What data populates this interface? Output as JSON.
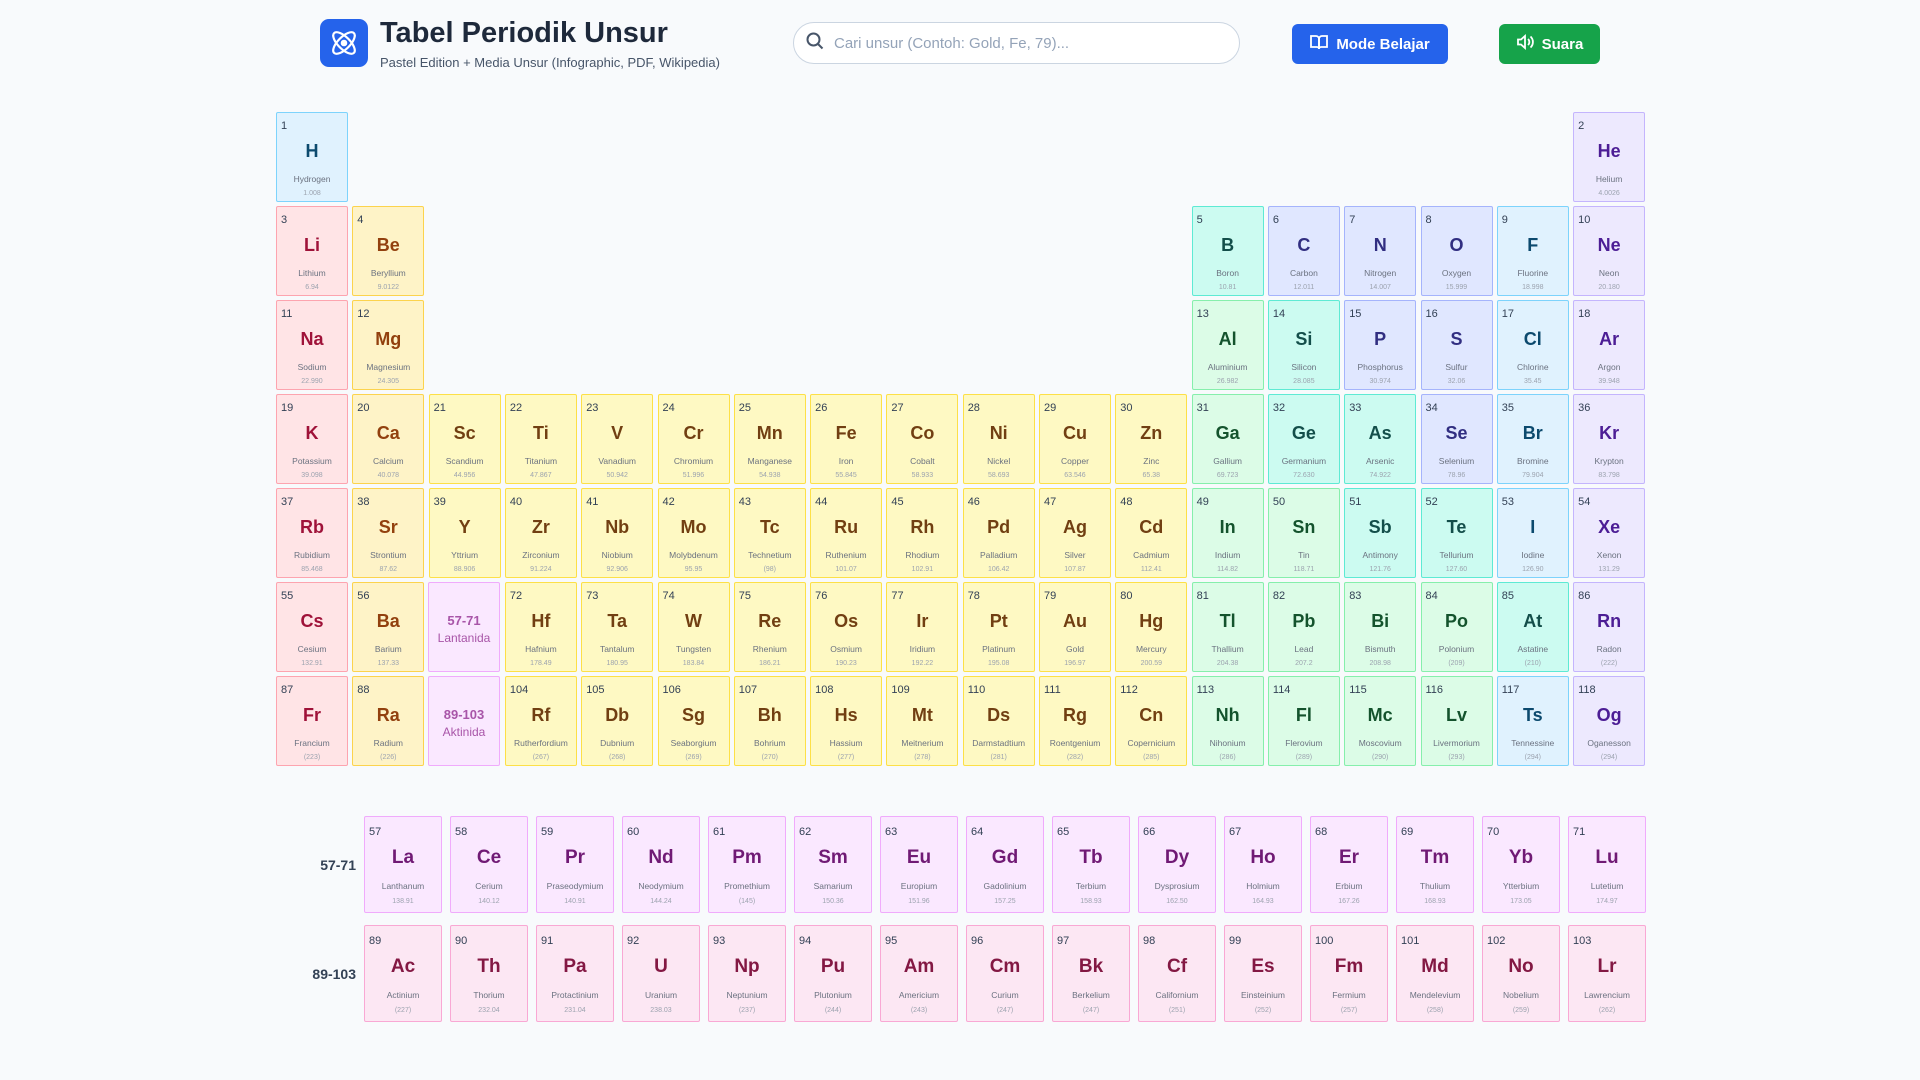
{
  "header": {
    "title": "Tabel Periodik Unsur",
    "subtitle": "Pastel Edition + Media Unsur (Infographic, PDF, Wikipedia)",
    "search_placeholder": "Cari unsur (Contoh: Gold, Fe, 79)...",
    "learn_label": "Mode Belajar",
    "sound_label": "Suara"
  },
  "placeholders": {
    "lanthanide": {
      "range": "57-71",
      "label": "Lantanida"
    },
    "actinide": {
      "range": "89-103",
      "label": "Aktinida"
    }
  },
  "row_labels": {
    "lanthanide": "57-71",
    "actinide": "89-103"
  },
  "elements": [
    {
      "n": 1,
      "s": "H",
      "name": "Hydrogen",
      "m": "1.008",
      "c": "h",
      "g": 1,
      "p": 1
    },
    {
      "n": 2,
      "s": "He",
      "name": "Helium",
      "m": "4.0026",
      "c": "ng",
      "g": 18,
      "p": 1
    },
    {
      "n": 3,
      "s": "Li",
      "name": "Lithium",
      "m": "6.94",
      "c": "alk",
      "g": 1,
      "p": 2
    },
    {
      "n": 4,
      "s": "Be",
      "name": "Beryllium",
      "m": "9.0122",
      "c": "ae",
      "g": 2,
      "p": 2
    },
    {
      "n": 5,
      "s": "B",
      "name": "Boron",
      "m": "10.81",
      "c": "met",
      "g": 13,
      "p": 2
    },
    {
      "n": 6,
      "s": "C",
      "name": "Carbon",
      "m": "12.011",
      "c": "nm",
      "g": 14,
      "p": 2
    },
    {
      "n": 7,
      "s": "N",
      "name": "Nitrogen",
      "m": "14.007",
      "c": "nm",
      "g": 15,
      "p": 2
    },
    {
      "n": 8,
      "s": "O",
      "name": "Oxygen",
      "m": "15.999",
      "c": "nm",
      "g": 16,
      "p": 2
    },
    {
      "n": 9,
      "s": "F",
      "name": "Fluorine",
      "m": "18.998",
      "c": "hal",
      "g": 17,
      "p": 2
    },
    {
      "n": 10,
      "s": "Ne",
      "name": "Neon",
      "m": "20.180",
      "c": "ng",
      "g": 18,
      "p": 2
    },
    {
      "n": 11,
      "s": "Na",
      "name": "Sodium",
      "m": "22.990",
      "c": "alk",
      "g": 1,
      "p": 3
    },
    {
      "n": 12,
      "s": "Mg",
      "name": "Magnesium",
      "m": "24.305",
      "c": "ae",
      "g": 2,
      "p": 3
    },
    {
      "n": 13,
      "s": "Al",
      "name": "Aluminium",
      "m": "26.982",
      "c": "pt",
      "g": 13,
      "p": 3
    },
    {
      "n": 14,
      "s": "Si",
      "name": "Silicon",
      "m": "28.085",
      "c": "met",
      "g": 14,
      "p": 3
    },
    {
      "n": 15,
      "s": "P",
      "name": "Phosphorus",
      "m": "30.974",
      "c": "nm",
      "g": 15,
      "p": 3
    },
    {
      "n": 16,
      "s": "S",
      "name": "Sulfur",
      "m": "32.06",
      "c": "nm",
      "g": 16,
      "p": 3
    },
    {
      "n": 17,
      "s": "Cl",
      "name": "Chlorine",
      "m": "35.45",
      "c": "hal",
      "g": 17,
      "p": 3
    },
    {
      "n": 18,
      "s": "Ar",
      "name": "Argon",
      "m": "39.948",
      "c": "ng",
      "g": 18,
      "p": 3
    },
    {
      "n": 19,
      "s": "K",
      "name": "Potassium",
      "m": "39.098",
      "c": "alk",
      "g": 1,
      "p": 4
    },
    {
      "n": 20,
      "s": "Ca",
      "name": "Calcium",
      "m": "40.078",
      "c": "ae",
      "g": 2,
      "p": 4
    },
    {
      "n": 21,
      "s": "Sc",
      "name": "Scandium",
      "m": "44.956",
      "c": "tm",
      "g": 3,
      "p": 4
    },
    {
      "n": 22,
      "s": "Ti",
      "name": "Titanium",
      "m": "47.867",
      "c": "tm",
      "g": 4,
      "p": 4
    },
    {
      "n": 23,
      "s": "V",
      "name": "Vanadium",
      "m": "50.942",
      "c": "tm",
      "g": 5,
      "p": 4
    },
    {
      "n": 24,
      "s": "Cr",
      "name": "Chromium",
      "m": "51.996",
      "c": "tm",
      "g": 6,
      "p": 4
    },
    {
      "n": 25,
      "s": "Mn",
      "name": "Manganese",
      "m": "54.938",
      "c": "tm",
      "g": 7,
      "p": 4
    },
    {
      "n": 26,
      "s": "Fe",
      "name": "Iron",
      "m": "55.845",
      "c": "tm",
      "g": 8,
      "p": 4
    },
    {
      "n": 27,
      "s": "Co",
      "name": "Cobalt",
      "m": "58.933",
      "c": "tm",
      "g": 9,
      "p": 4
    },
    {
      "n": 28,
      "s": "Ni",
      "name": "Nickel",
      "m": "58.693",
      "c": "tm",
      "g": 10,
      "p": 4
    },
    {
      "n": 29,
      "s": "Cu",
      "name": "Copper",
      "m": "63.546",
      "c": "tm",
      "g": 11,
      "p": 4
    },
    {
      "n": 30,
      "s": "Zn",
      "name": "Zinc",
      "m": "65.38",
      "c": "tm",
      "g": 12,
      "p": 4
    },
    {
      "n": 31,
      "s": "Ga",
      "name": "Gallium",
      "m": "69.723",
      "c": "pt",
      "g": 13,
      "p": 4
    },
    {
      "n": 32,
      "s": "Ge",
      "name": "Germanium",
      "m": "72.630",
      "c": "met",
      "g": 14,
      "p": 4
    },
    {
      "n": 33,
      "s": "As",
      "name": "Arsenic",
      "m": "74.922",
      "c": "met",
      "g": 15,
      "p": 4
    },
    {
      "n": 34,
      "s": "Se",
      "name": "Selenium",
      "m": "78.96",
      "c": "nm",
      "g": 16,
      "p": 4
    },
    {
      "n": 35,
      "s": "Br",
      "name": "Bromine",
      "m": "79.904",
      "c": "hal",
      "g": 17,
      "p": 4
    },
    {
      "n": 36,
      "s": "Kr",
      "name": "Krypton",
      "m": "83.798",
      "c": "ng",
      "g": 18,
      "p": 4
    },
    {
      "n": 37,
      "s": "Rb",
      "name": "Rubidium",
      "m": "85.468",
      "c": "alk",
      "g": 1,
      "p": 5
    },
    {
      "n": 38,
      "s": "Sr",
      "name": "Strontium",
      "m": "87.62",
      "c": "ae",
      "g": 2,
      "p": 5
    },
    {
      "n": 39,
      "s": "Y",
      "name": "Yttrium",
      "m": "88.906",
      "c": "tm",
      "g": 3,
      "p": 5
    },
    {
      "n": 40,
      "s": "Zr",
      "name": "Zirconium",
      "m": "91.224",
      "c": "tm",
      "g": 4,
      "p": 5
    },
    {
      "n": 41,
      "s": "Nb",
      "name": "Niobium",
      "m": "92.906",
      "c": "tm",
      "g": 5,
      "p": 5
    },
    {
      "n": 42,
      "s": "Mo",
      "name": "Molybdenum",
      "m": "95.95",
      "c": "tm",
      "g": 6,
      "p": 5
    },
    {
      "n": 43,
      "s": "Tc",
      "name": "Technetium",
      "m": "(98)",
      "c": "tm",
      "g": 7,
      "p": 5
    },
    {
      "n": 44,
      "s": "Ru",
      "name": "Ruthenium",
      "m": "101.07",
      "c": "tm",
      "g": 8,
      "p": 5
    },
    {
      "n": 45,
      "s": "Rh",
      "name": "Rhodium",
      "m": "102.91",
      "c": "tm",
      "g": 9,
      "p": 5
    },
    {
      "n": 46,
      "s": "Pd",
      "name": "Palladium",
      "m": "106.42",
      "c": "tm",
      "g": 10,
      "p": 5
    },
    {
      "n": 47,
      "s": "Ag",
      "name": "Silver",
      "m": "107.87",
      "c": "tm",
      "g": 11,
      "p": 5
    },
    {
      "n": 48,
      "s": "Cd",
      "name": "Cadmium",
      "m": "112.41",
      "c": "tm",
      "g": 12,
      "p": 5
    },
    {
      "n": 49,
      "s": "In",
      "name": "Indium",
      "m": "114.82",
      "c": "pt",
      "g": 13,
      "p": 5
    },
    {
      "n": 50,
      "s": "Sn",
      "name": "Tin",
      "m": "118.71",
      "c": "pt",
      "g": 14,
      "p": 5
    },
    {
      "n": 51,
      "s": "Sb",
      "name": "Antimony",
      "m": "121.76",
      "c": "met",
      "g": 15,
      "p": 5
    },
    {
      "n": 52,
      "s": "Te",
      "name": "Tellurium",
      "m": "127.60",
      "c": "met",
      "g": 16,
      "p": 5
    },
    {
      "n": 53,
      "s": "I",
      "name": "Iodine",
      "m": "126.90",
      "c": "hal",
      "g": 17,
      "p": 5
    },
    {
      "n": 54,
      "s": "Xe",
      "name": "Xenon",
      "m": "131.29",
      "c": "ng",
      "g": 18,
      "p": 5
    },
    {
      "n": 55,
      "s": "Cs",
      "name": "Cesium",
      "m": "132.91",
      "c": "alk",
      "g": 1,
      "p": 6
    },
    {
      "n": 56,
      "s": "Ba",
      "name": "Barium",
      "m": "137.33",
      "c": "ae",
      "g": 2,
      "p": 6
    },
    {
      "n": 72,
      "s": "Hf",
      "name": "Hafnium",
      "m": "178.49",
      "c": "tm",
      "g": 4,
      "p": 6
    },
    {
      "n": 73,
      "s": "Ta",
      "name": "Tantalum",
      "m": "180.95",
      "c": "tm",
      "g": 5,
      "p": 6
    },
    {
      "n": 74,
      "s": "W",
      "name": "Tungsten",
      "m": "183.84",
      "c": "tm",
      "g": 6,
      "p": 6
    },
    {
      "n": 75,
      "s": "Re",
      "name": "Rhenium",
      "m": "186.21",
      "c": "tm",
      "g": 7,
      "p": 6
    },
    {
      "n": 76,
      "s": "Os",
      "name": "Osmium",
      "m": "190.23",
      "c": "tm",
      "g": 8,
      "p": 6
    },
    {
      "n": 77,
      "s": "Ir",
      "name": "Iridium",
      "m": "192.22",
      "c": "tm",
      "g": 9,
      "p": 6
    },
    {
      "n": 78,
      "s": "Pt",
      "name": "Platinum",
      "m": "195.08",
      "c": "tm",
      "g": 10,
      "p": 6
    },
    {
      "n": 79,
      "s": "Au",
      "name": "Gold",
      "m": "196.97",
      "c": "tm",
      "g": 11,
      "p": 6
    },
    {
      "n": 80,
      "s": "Hg",
      "name": "Mercury",
      "m": "200.59",
      "c": "tm",
      "g": 12,
      "p": 6
    },
    {
      "n": 81,
      "s": "Tl",
      "name": "Thallium",
      "m": "204.38",
      "c": "pt",
      "g": 13,
      "p": 6
    },
    {
      "n": 82,
      "s": "Pb",
      "name": "Lead",
      "m": "207.2",
      "c": "pt",
      "g": 14,
      "p": 6
    },
    {
      "n": 83,
      "s": "Bi",
      "name": "Bismuth",
      "m": "208.98",
      "c": "pt",
      "g": 15,
      "p": 6
    },
    {
      "n": 84,
      "s": "Po",
      "name": "Polonium",
      "m": "(209)",
      "c": "pt",
      "g": 16,
      "p": 6
    },
    {
      "n": 85,
      "s": "At",
      "name": "Astatine",
      "m": "(210)",
      "c": "met",
      "g": 17,
      "p": 6
    },
    {
      "n": 86,
      "s": "Rn",
      "name": "Radon",
      "m": "(222)",
      "c": "ng",
      "g": 18,
      "p": 6
    },
    {
      "n": 87,
      "s": "Fr",
      "name": "Francium",
      "m": "(223)",
      "c": "alk",
      "g": 1,
      "p": 7
    },
    {
      "n": 88,
      "s": "Ra",
      "name": "Radium",
      "m": "(226)",
      "c": "ae",
      "g": 2,
      "p": 7
    },
    {
      "n": 104,
      "s": "Rf",
      "name": "Rutherfordium",
      "m": "(267)",
      "c": "tm",
      "g": 4,
      "p": 7
    },
    {
      "n": 105,
      "s": "Db",
      "name": "Dubnium",
      "m": "(268)",
      "c": "tm",
      "g": 5,
      "p": 7
    },
    {
      "n": 106,
      "s": "Sg",
      "name": "Seaborgium",
      "m": "(269)",
      "c": "tm",
      "g": 6,
      "p": 7
    },
    {
      "n": 107,
      "s": "Bh",
      "name": "Bohrium",
      "m": "(270)",
      "c": "tm",
      "g": 7,
      "p": 7
    },
    {
      "n": 108,
      "s": "Hs",
      "name": "Hassium",
      "m": "(277)",
      "c": "tm",
      "g": 8,
      "p": 7
    },
    {
      "n": 109,
      "s": "Mt",
      "name": "Meitnerium",
      "m": "(278)",
      "c": "tm",
      "g": 9,
      "p": 7
    },
    {
      "n": 110,
      "s": "Ds",
      "name": "Darmstadtium",
      "m": "(281)",
      "c": "tm",
      "g": 10,
      "p": 7
    },
    {
      "n": 111,
      "s": "Rg",
      "name": "Roentgenium",
      "m": "(282)",
      "c": "tm",
      "g": 11,
      "p": 7
    },
    {
      "n": 112,
      "s": "Cn",
      "name": "Copernicium",
      "m": "(285)",
      "c": "tm",
      "g": 12,
      "p": 7
    },
    {
      "n": 113,
      "s": "Nh",
      "name": "Nihonium",
      "m": "(286)",
      "c": "pt",
      "g": 13,
      "p": 7
    },
    {
      "n": 114,
      "s": "Fl",
      "name": "Flerovium",
      "m": "(289)",
      "c": "pt",
      "g": 14,
      "p": 7
    },
    {
      "n": 115,
      "s": "Mc",
      "name": "Moscovium",
      "m": "(290)",
      "c": "pt",
      "g": 15,
      "p": 7
    },
    {
      "n": 116,
      "s": "Lv",
      "name": "Livermorium",
      "m": "(293)",
      "c": "pt",
      "g": 16,
      "p": 7
    },
    {
      "n": 117,
      "s": "Ts",
      "name": "Tennessine",
      "m": "(294)",
      "c": "hal",
      "g": 17,
      "p": 7
    },
    {
      "n": 118,
      "s": "Og",
      "name": "Oganesson",
      "m": "(294)",
      "c": "ng",
      "g": 18,
      "p": 7
    }
  ],
  "lanthanides": [
    {
      "n": 57,
      "s": "La",
      "name": "Lanthanum",
      "m": "138.91"
    },
    {
      "n": 58,
      "s": "Ce",
      "name": "Cerium",
      "m": "140.12"
    },
    {
      "n": 59,
      "s": "Pr",
      "name": "Praseodymium",
      "m": "140.91"
    },
    {
      "n": 60,
      "s": "Nd",
      "name": "Neodymium",
      "m": "144.24"
    },
    {
      "n": 61,
      "s": "Pm",
      "name": "Promethium",
      "m": "(145)"
    },
    {
      "n": 62,
      "s": "Sm",
      "name": "Samarium",
      "m": "150.36"
    },
    {
      "n": 63,
      "s": "Eu",
      "name": "Europium",
      "m": "151.96"
    },
    {
      "n": 64,
      "s": "Gd",
      "name": "Gadolinium",
      "m": "157.25"
    },
    {
      "n": 65,
      "s": "Tb",
      "name": "Terbium",
      "m": "158.93"
    },
    {
      "n": 66,
      "s": "Dy",
      "name": "Dysprosium",
      "m": "162.50"
    },
    {
      "n": 67,
      "s": "Ho",
      "name": "Holmium",
      "m": "164.93"
    },
    {
      "n": 68,
      "s": "Er",
      "name": "Erbium",
      "m": "167.26"
    },
    {
      "n": 69,
      "s": "Tm",
      "name": "Thulium",
      "m": "168.93"
    },
    {
      "n": 70,
      "s": "Yb",
      "name": "Ytterbium",
      "m": "173.05"
    },
    {
      "n": 71,
      "s": "Lu",
      "name": "Lutetium",
      "m": "174.97"
    }
  ],
  "actinides": [
    {
      "n": 89,
      "s": "Ac",
      "name": "Actinium",
      "m": "(227)"
    },
    {
      "n": 90,
      "s": "Th",
      "name": "Thorium",
      "m": "232.04"
    },
    {
      "n": 91,
      "s": "Pa",
      "name": "Protactinium",
      "m": "231.04"
    },
    {
      "n": 92,
      "s": "U",
      "name": "Uranium",
      "m": "238.03"
    },
    {
      "n": 93,
      "s": "Np",
      "name": "Neptunium",
      "m": "(237)"
    },
    {
      "n": 94,
      "s": "Pu",
      "name": "Plutonium",
      "m": "(244)"
    },
    {
      "n": 95,
      "s": "Am",
      "name": "Americium",
      "m": "(243)"
    },
    {
      "n": 96,
      "s": "Cm",
      "name": "Curium",
      "m": "(247)"
    },
    {
      "n": 97,
      "s": "Bk",
      "name": "Berkelium",
      "m": "(247)"
    },
    {
      "n": 98,
      "s": "Cf",
      "name": "Californium",
      "m": "(251)"
    },
    {
      "n": 99,
      "s": "Es",
      "name": "Einsteinium",
      "m": "(252)"
    },
    {
      "n": 100,
      "s": "Fm",
      "name": "Fermium",
      "m": "(257)"
    },
    {
      "n": 101,
      "s": "Md",
      "name": "Mendelevium",
      "m": "(258)"
    },
    {
      "n": 102,
      "s": "No",
      "name": "Nobelium",
      "m": "(259)"
    },
    {
      "n": 103,
      "s": "Lr",
      "name": "Lawrencium",
      "m": "(262)"
    }
  ]
}
